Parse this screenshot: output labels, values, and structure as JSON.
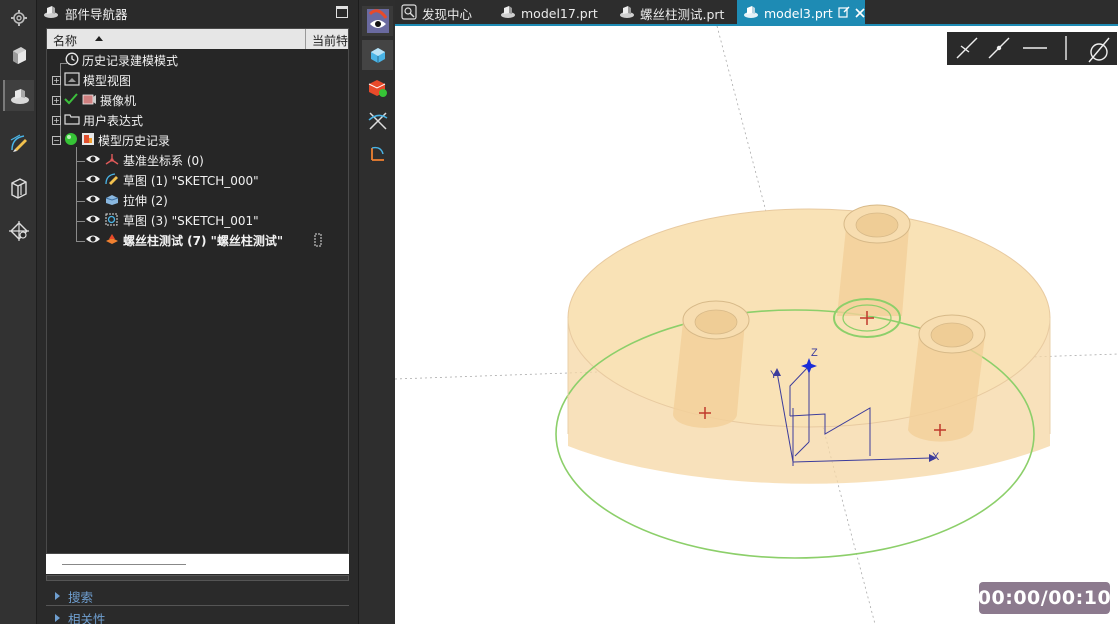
{
  "navigator": {
    "title": "部件导航器",
    "columns": {
      "name": "名称",
      "current": "当前特"
    },
    "nodes": [
      {
        "label": "历史记录建模模式"
      },
      {
        "label": "模型视图"
      },
      {
        "label": "摄像机"
      },
      {
        "label": "用户表达式"
      },
      {
        "label": "模型历史记录"
      },
      {
        "label": "基准坐标系 (0)"
      },
      {
        "label": "草图 (1) \"SKETCH_000\""
      },
      {
        "label": "拉伸 (2)"
      },
      {
        "label": "草图 (3) \"SKETCH_001\""
      },
      {
        "label": "螺丝柱测试 (7) \"螺丝柱测试\""
      }
    ],
    "sections": {
      "search": "搜索",
      "related": "相关性"
    }
  },
  "tabs": [
    {
      "label": "发现中心",
      "icon": "discover-icon"
    },
    {
      "label": "model17.prt",
      "icon": "part-icon"
    },
    {
      "label": "螺丝柱测试.prt",
      "icon": "part-icon"
    },
    {
      "label": "model3.prt",
      "icon": "part-icon",
      "active": true
    }
  ],
  "viewport": {
    "axes": {
      "x": "X",
      "y": "Y",
      "z": "Z"
    },
    "timer": "00:00/00:10"
  },
  "colors": {
    "accent": "#1e8bb4",
    "model_fill": "#f8deab",
    "model_edge": "#8ccf6a",
    "center_mark": "#c0392b",
    "triad": "#3c3c9c"
  }
}
